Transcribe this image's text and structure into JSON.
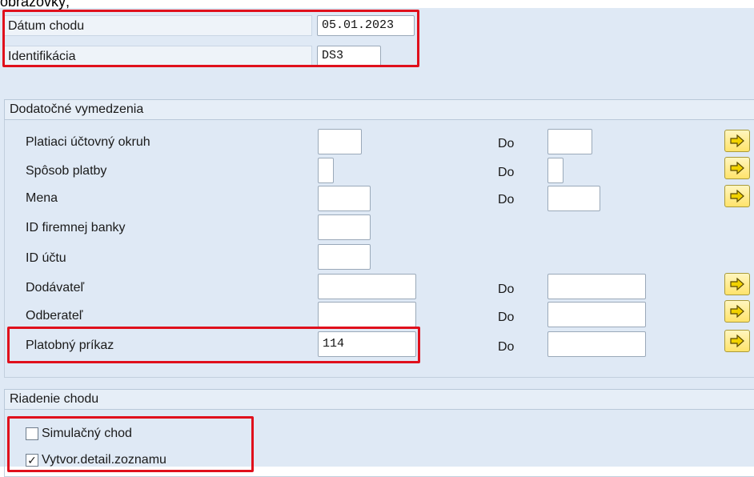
{
  "caption": "obrazovky;",
  "header_fields": {
    "run_date": {
      "label": "Dátum chodu",
      "value": "05.01.2023"
    },
    "identification": {
      "label": "Identifikácia",
      "value": "DS3"
    }
  },
  "additional": {
    "title": "Dodatočné vymedzenia",
    "to_label": "Do",
    "rows": [
      {
        "label": "Platiaci účtovný okruh",
        "value": ""
      },
      {
        "label": "Spôsob platby",
        "value": ""
      },
      {
        "label": "Mena",
        "value": ""
      },
      {
        "label": "ID firemnej banky",
        "value": ""
      },
      {
        "label": "ID účtu",
        "value": ""
      },
      {
        "label": "Dodávateľ",
        "value": ""
      },
      {
        "label": "Odberateľ",
        "value": ""
      },
      {
        "label": "Platobný príkaz",
        "value": "114"
      }
    ]
  },
  "run_control": {
    "title": "Riadenie chodu",
    "simulation": {
      "label": "Simulačný chod",
      "checked": false
    },
    "detail_list": {
      "label": "Vytvor.detail.zoznamu",
      "checked": true
    }
  },
  "icons": {
    "multiple_selection": "arrow-right-icon"
  },
  "colors": {
    "highlight": "#e0101c",
    "arrow_button": "#ffe36b"
  }
}
